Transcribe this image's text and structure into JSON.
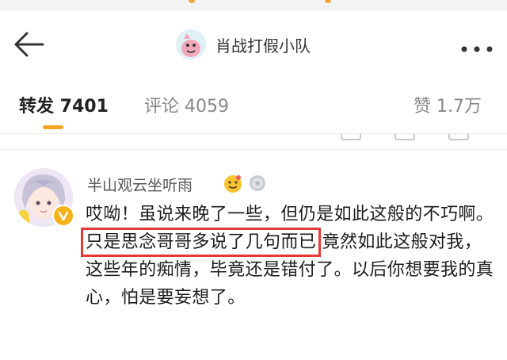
{
  "header": {
    "title": "肖战打假小队"
  },
  "tabs": [
    {
      "label": "转发 7401"
    },
    {
      "label": "评论 4059"
    },
    {
      "label": "赞 1.7万"
    }
  ],
  "comment": {
    "username": "半山观云坐听雨",
    "text_before": "哎呦！虽说来晚了一些，但仍是如此这般的不巧啊。",
    "text_highlight": "只是思念哥哥多说了几句而已",
    "text_after": "  竟然如此这般对我，这些年的痴情，毕竟还是错付了。以后你想要我的真心，怕是要妄想了。"
  },
  "icons": {
    "back": "back-arrow-icon",
    "more": "more-dots-icon",
    "verified": "verified-badge-icon",
    "medal": "medal-icon"
  },
  "colors": {
    "accent": "#f5a623",
    "highlight_box": "#e53935",
    "verified_badge": "#f5b21b"
  }
}
